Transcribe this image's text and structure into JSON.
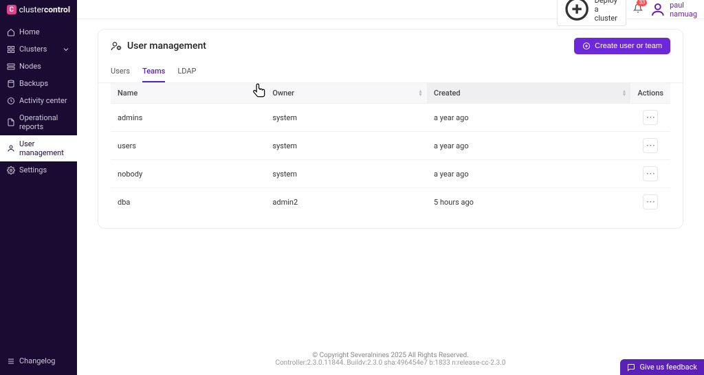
{
  "brand": {
    "mark": "C",
    "name_light": "cluster",
    "name_bold": "control"
  },
  "sidebar": {
    "items": [
      {
        "label": "Home"
      },
      {
        "label": "Clusters",
        "expandable": true
      },
      {
        "label": "Nodes"
      },
      {
        "label": "Backups"
      },
      {
        "label": "Activity center"
      },
      {
        "label": "Operational reports"
      },
      {
        "label": "User management",
        "active": true
      },
      {
        "label": "Settings"
      }
    ],
    "changelog": "Changelog"
  },
  "topbar": {
    "deploy": "Deploy a cluster",
    "notifications": "33",
    "user": "paul namuag"
  },
  "page": {
    "title": "User management",
    "create_btn": "Create user or team",
    "tabs": {
      "users": "Users",
      "teams": "Teams",
      "ldap": "LDAP"
    },
    "active_tab": "teams",
    "columns": {
      "name": "Name",
      "owner": "Owner",
      "created": "Created",
      "actions": "Actions"
    },
    "rows": [
      {
        "name": "admins",
        "owner": "system",
        "created": "a year ago"
      },
      {
        "name": "users",
        "owner": "system",
        "created": "a year ago"
      },
      {
        "name": "nobody",
        "owner": "system",
        "created": "a year ago"
      },
      {
        "name": "dba",
        "owner": "admin2",
        "created": "5 hours ago"
      }
    ]
  },
  "footer": {
    "line1": "© Copyright Severalnines 2025 All Rights Reserved.",
    "line2": "Controller:2.3.0.11844. Buildv:2.3.0 sha:496454e7 b:1833 n:release-cc-2.3.0"
  },
  "feedback": "Give us feedback"
}
